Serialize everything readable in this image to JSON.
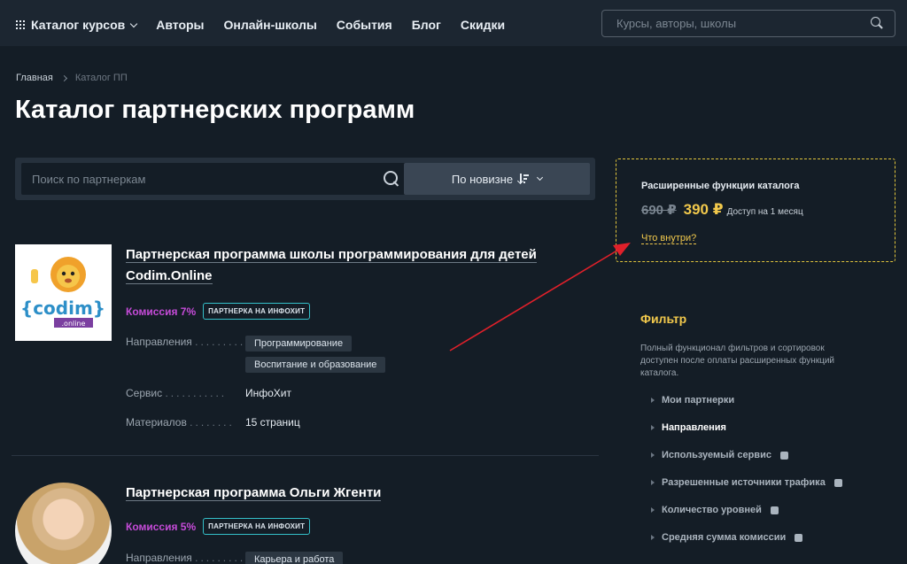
{
  "nav": {
    "catalog_label": "Каталог курсов",
    "items": [
      "Авторы",
      "Онлайн-школы",
      "События",
      "Блог",
      "Скидки"
    ],
    "search_placeholder": "Курсы, авторы, школы"
  },
  "breadcrumb": {
    "home": "Главная",
    "current": "Каталог ПП"
  },
  "page_title": "Каталог партнерских программ",
  "partner_search": {
    "placeholder": "Поиск по партнеркам",
    "sort_label": "По новизне"
  },
  "cards": [
    {
      "title": "Партнерская программа школы программирования для детей Codim.Online",
      "commission": "Комиссия 7%",
      "badge": "ПАРТНЕРКА НА ИНФОХИТ",
      "props": {
        "directions_label": "Направления",
        "directions": [
          "Программирование",
          "Воспитание и образование"
        ],
        "service_label": "Сервис",
        "service": "ИнфоХит",
        "materials_label": "Материалов",
        "materials": "15 страниц"
      },
      "logo": {
        "brand": "{codim}",
        "sub": ".online"
      }
    },
    {
      "title": "Партнерская программа Ольги Жгенти",
      "commission": "Комиссия 5%",
      "badge": "ПАРТНЕРКА НА ИНФОХИТ",
      "props": {
        "directions_label": "Направления",
        "directions": [
          "Карьера и работа"
        ]
      }
    }
  ],
  "promo": {
    "title": "Расширенные функции каталога",
    "old_price": "690 ₽",
    "new_price": "390 ₽",
    "note": "Доступ на 1 месяц",
    "link": "Что внутри?"
  },
  "filter": {
    "title": "Фильтр",
    "desc": "Полный функционал фильтров и сортировок доступен после оплаты расширенных функций каталога.",
    "items": [
      "Мои партнерки",
      "Направления",
      "Используемый сервис",
      "Разрешенные источники трафика",
      "Количество уровней",
      "Средняя сумма комиссии"
    ]
  },
  "colors": {
    "accent_yellow": "#f2c94c",
    "commission_purple": "#c54bd8",
    "badge_border": "#34c0c9",
    "arrow_red": "#e0202a"
  }
}
